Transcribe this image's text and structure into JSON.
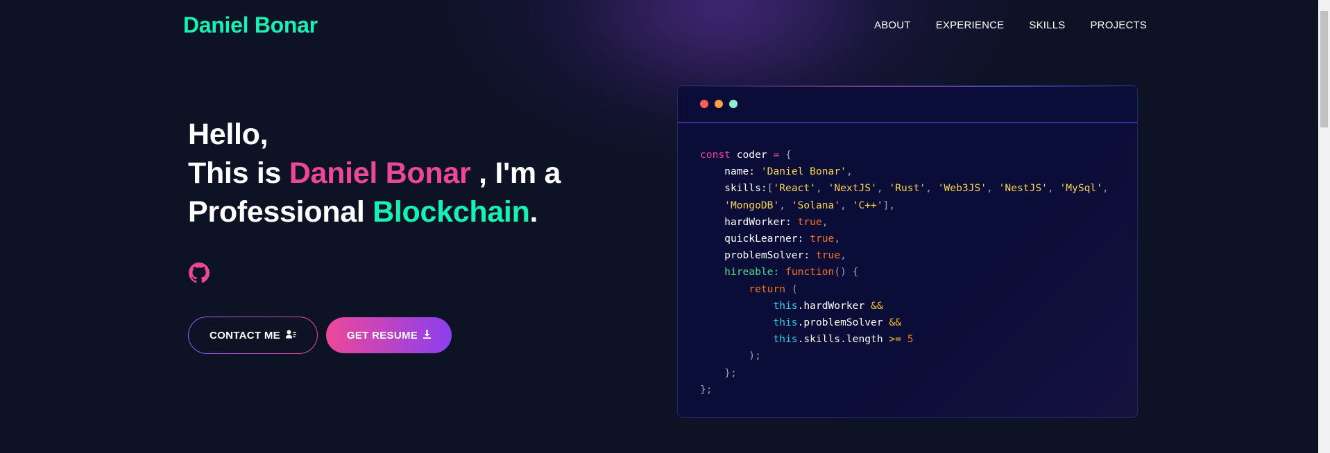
{
  "brand": "Daniel Bonar",
  "nav": [
    "ABOUT",
    "EXPERIENCE",
    "SKILLS",
    "PROJECTS"
  ],
  "hero": {
    "line1": "Hello,",
    "this_is": "This is ",
    "name": "Daniel Bonar",
    "im_a": " , I'm a",
    "professional": "Professional ",
    "role": "Blockchain",
    "period": "."
  },
  "buttons": {
    "contact": "CONTACT ME",
    "resume": "GET RESUME"
  },
  "icons": {
    "github": "github-icon",
    "contact": "user-card-icon",
    "resume": "download-icon"
  },
  "colors": {
    "accent_green": "#16f2b3",
    "accent_pink": "#ec4899",
    "accent_purple": "#8b5cf6",
    "background": "#0d1224"
  },
  "code": {
    "window_dots": [
      "#ff5f56",
      "#ff9f43",
      "#8ef0c8"
    ],
    "name_value": "'Daniel Bonar'",
    "skills_line1": [
      "'React'",
      "'NextJS'",
      "'Rust'",
      "'Web3JS'",
      "'NestJS'",
      "'MySql'"
    ],
    "skills_line2": [
      "'MongoDB'",
      "'Solana'",
      "'C++'"
    ],
    "hardWorker": "true",
    "quickLearner": "true",
    "problemSolver": "true",
    "length_value": "5"
  }
}
